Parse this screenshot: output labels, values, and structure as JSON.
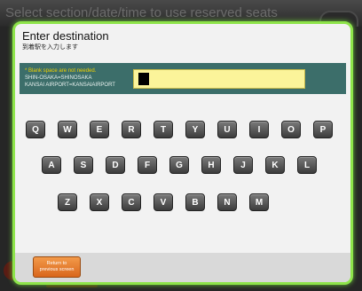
{
  "background": {
    "title": "Select section/date/time to use reserved seats"
  },
  "modal": {
    "title": "Enter destination",
    "subtitle": "到着駅を入力します",
    "note_line1": "* Blank space are not needed.",
    "note_line2": "SHIN-OSAKA=SHINOSAKA",
    "note_line3": "KANSAI AIRPORT=KANSAIAIRPORT",
    "input_value": ""
  },
  "keyboard": {
    "row1": [
      "Q",
      "W",
      "E",
      "R",
      "T",
      "Y",
      "U",
      "I",
      "O",
      "P"
    ],
    "row2": [
      "A",
      "S",
      "D",
      "F",
      "G",
      "H",
      "J",
      "K",
      "L"
    ],
    "row3": [
      "Z",
      "X",
      "C",
      "V",
      "B",
      "N",
      "M"
    ]
  },
  "footer": {
    "return_label_line1": "Return to",
    "return_label_line2": "previous screen"
  },
  "colors": {
    "modal_border": "#8ee44a",
    "band": "#3c6e6a",
    "input_bg": "#fbf49a",
    "return_button": "#e67a2e"
  }
}
